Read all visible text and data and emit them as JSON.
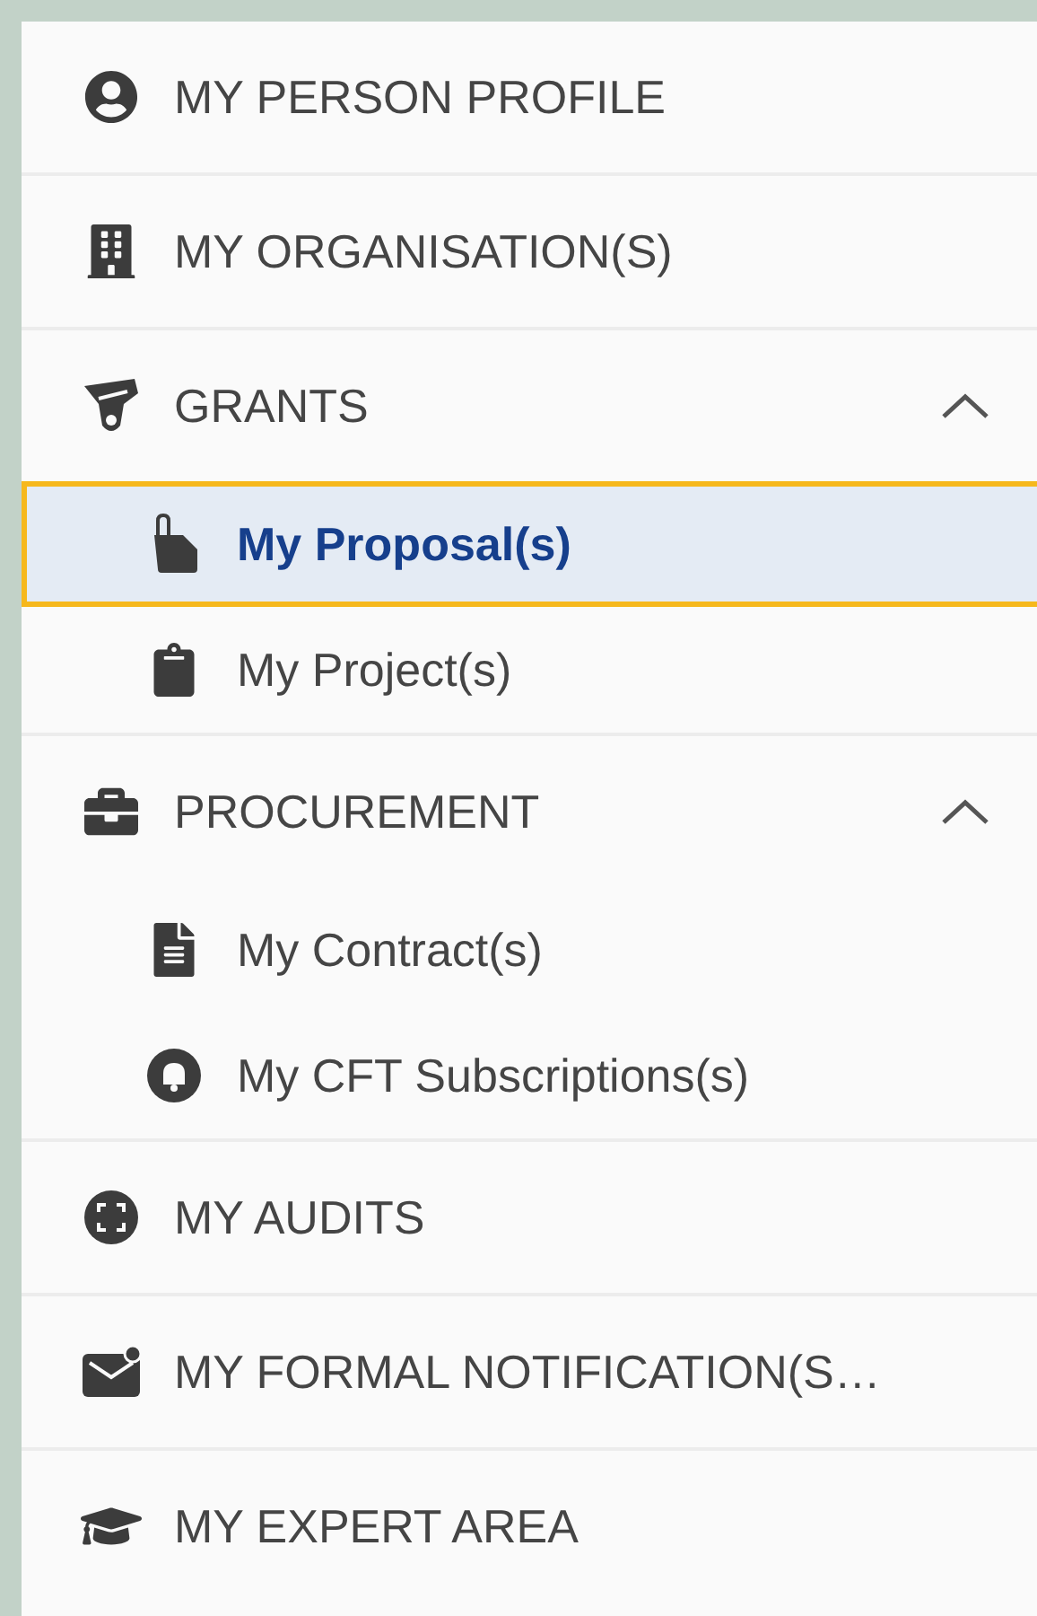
{
  "menu": [
    {
      "label": "MY PERSON PROFILE"
    },
    {
      "label": "MY ORGANISATION(S)"
    },
    {
      "label": "GRANTS",
      "expanded": true,
      "children": [
        {
          "label": "My Proposal(s)",
          "selected": true
        },
        {
          "label": "My Project(s)",
          "selected": false
        }
      ]
    },
    {
      "label": "PROCUREMENT",
      "expanded": true,
      "children": [
        {
          "label": "My Contract(s)",
          "selected": false
        },
        {
          "label": "My CFT Subscriptions(s)",
          "selected": false
        }
      ]
    },
    {
      "label": "MY AUDITS"
    },
    {
      "label": "MY FORMAL NOTIFICATION(S…"
    },
    {
      "label": "MY EXPERT AREA"
    }
  ]
}
